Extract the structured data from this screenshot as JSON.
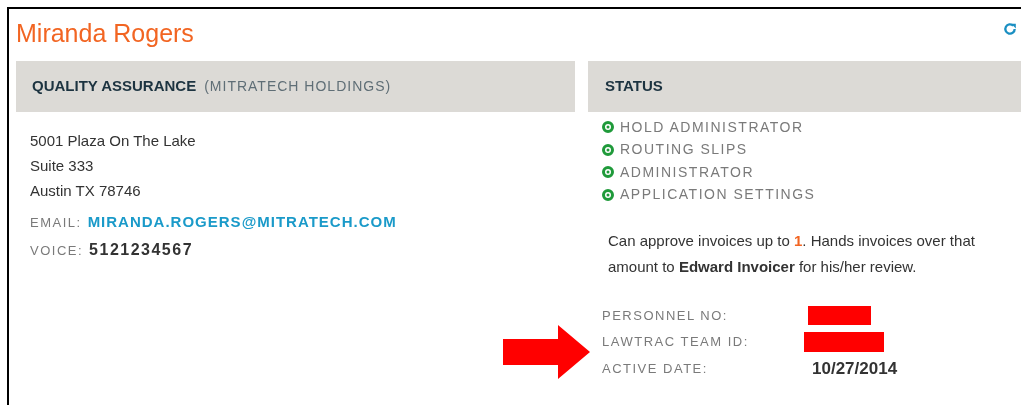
{
  "person": {
    "name": "Miranda Rogers"
  },
  "organization": {
    "department": "QUALITY ASSURANCE",
    "company": "(MITRATECH HOLDINGS)",
    "address_lines": [
      "5001 Plaza On The Lake",
      "Suite 333",
      "Austin TX 78746"
    ],
    "contacts": [
      {
        "label": "EMAIL:",
        "value": "MIRANDA.ROGERS@MITRATECH.COM",
        "kind": "link"
      },
      {
        "label": "VOICE:",
        "value": "5121234567",
        "kind": "text"
      }
    ]
  },
  "status": {
    "title": "STATUS",
    "roles": [
      {
        "label": "HOLD ADMINISTRATOR",
        "color": "#1f9a3a"
      },
      {
        "label": "ROUTING SLIPS",
        "color": "#1f9a3a"
      },
      {
        "label": "ADMINISTRATOR",
        "color": "#1f9a3a"
      },
      {
        "label": "APPLICATION SETTINGS",
        "color": "#1f9a3a"
      }
    ],
    "approval_note": {
      "prefix": "Can approve invoices up to ",
      "amount": "1",
      "middle": ". Hands invoices over that amount to ",
      "approver": "Edward Invoicer",
      "suffix": " for his/her review."
    },
    "fields": [
      {
        "label": "PERSONNEL NO:",
        "kind": "redacted"
      },
      {
        "label": "LAWTRAC TEAM ID:",
        "kind": "redacted"
      },
      {
        "label": "ACTIVE DATE:",
        "value": "10/27/2014",
        "kind": "text"
      }
    ]
  }
}
